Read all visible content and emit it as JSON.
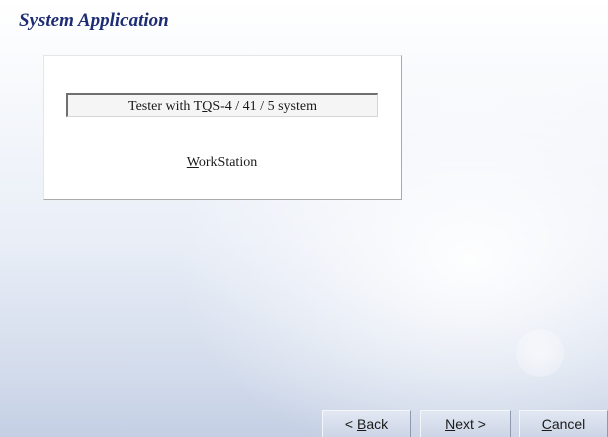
{
  "wizard": {
    "title": "System Application"
  },
  "options": [
    {
      "label_before": "Tester with T",
      "label_accel": "Q",
      "label_after": "S-4 / 41 / 5 system",
      "selected": true
    },
    {
      "label_before": "",
      "label_accel": "W",
      "label_after": "orkStation",
      "selected": false
    }
  ],
  "buttons": {
    "back": {
      "before": "< ",
      "accel": "B",
      "after": "ack"
    },
    "next": {
      "before": "",
      "accel": "N",
      "after": "ext >"
    },
    "cancel": {
      "before": "",
      "accel": "C",
      "after": "ancel"
    }
  }
}
